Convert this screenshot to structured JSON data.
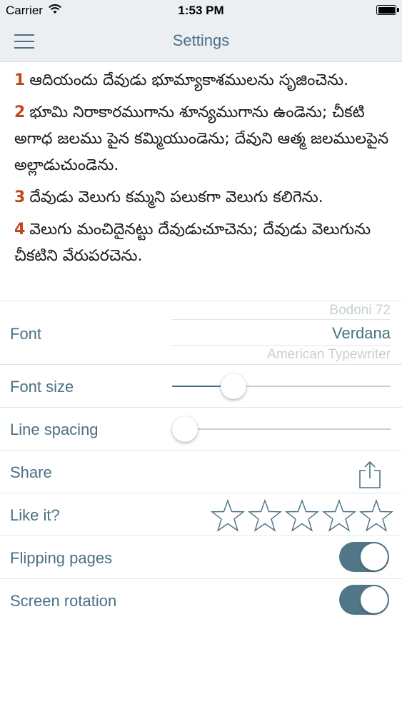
{
  "status_bar": {
    "carrier": "Carrier",
    "time": "1:53 PM",
    "battery_level": 1.0
  },
  "nav": {
    "title": "Settings",
    "menu_icon": "hamburger-menu-icon"
  },
  "preview": {
    "verses": [
      {
        "number": "1",
        "text": "ఆదియందు దేవుడు భూమ్యాకాశములను సృజించెను."
      },
      {
        "number": "2",
        "text": "భూమి నిరాకారముగాను శూన్యముగాను ఉండెను; చీకటి అగాధ జలము పైన కమ్మియుండెను; దేవుని ఆత్మ జలములపైన అల్లాడుచుండెను."
      },
      {
        "number": "3",
        "text": "దేవుడు వెలుగు కమ్మని పలుకగా వెలుగు కలిగెను."
      },
      {
        "number": "4",
        "text": "వెలుగు మంచిదైనట్టు దేవుడుచూచెను; దేవుడు వెలుగును చీకటిని వేరుపరచెను."
      }
    ]
  },
  "settings": {
    "font": {
      "label": "Font",
      "options": [
        "Bodoni 72",
        "Verdana",
        "American Typewriter"
      ],
      "selected": "Verdana"
    },
    "font_size": {
      "label": "Font size",
      "value": 0.25
    },
    "line_spacing": {
      "label": "Line spacing",
      "value": 0.0
    },
    "share": {
      "label": "Share",
      "icon": "share-icon"
    },
    "like": {
      "label": "Like it?",
      "stars_total": 5,
      "stars_filled": 0
    },
    "flipping_pages": {
      "label": "Flipping pages",
      "on": true
    },
    "screen_rotation": {
      "label": "Screen rotation",
      "on": true
    }
  },
  "colors": {
    "accent": "#4a7183",
    "verse_number": "#c2471b",
    "toggle_on": "#517687",
    "bar_bg": "#eceff2"
  }
}
